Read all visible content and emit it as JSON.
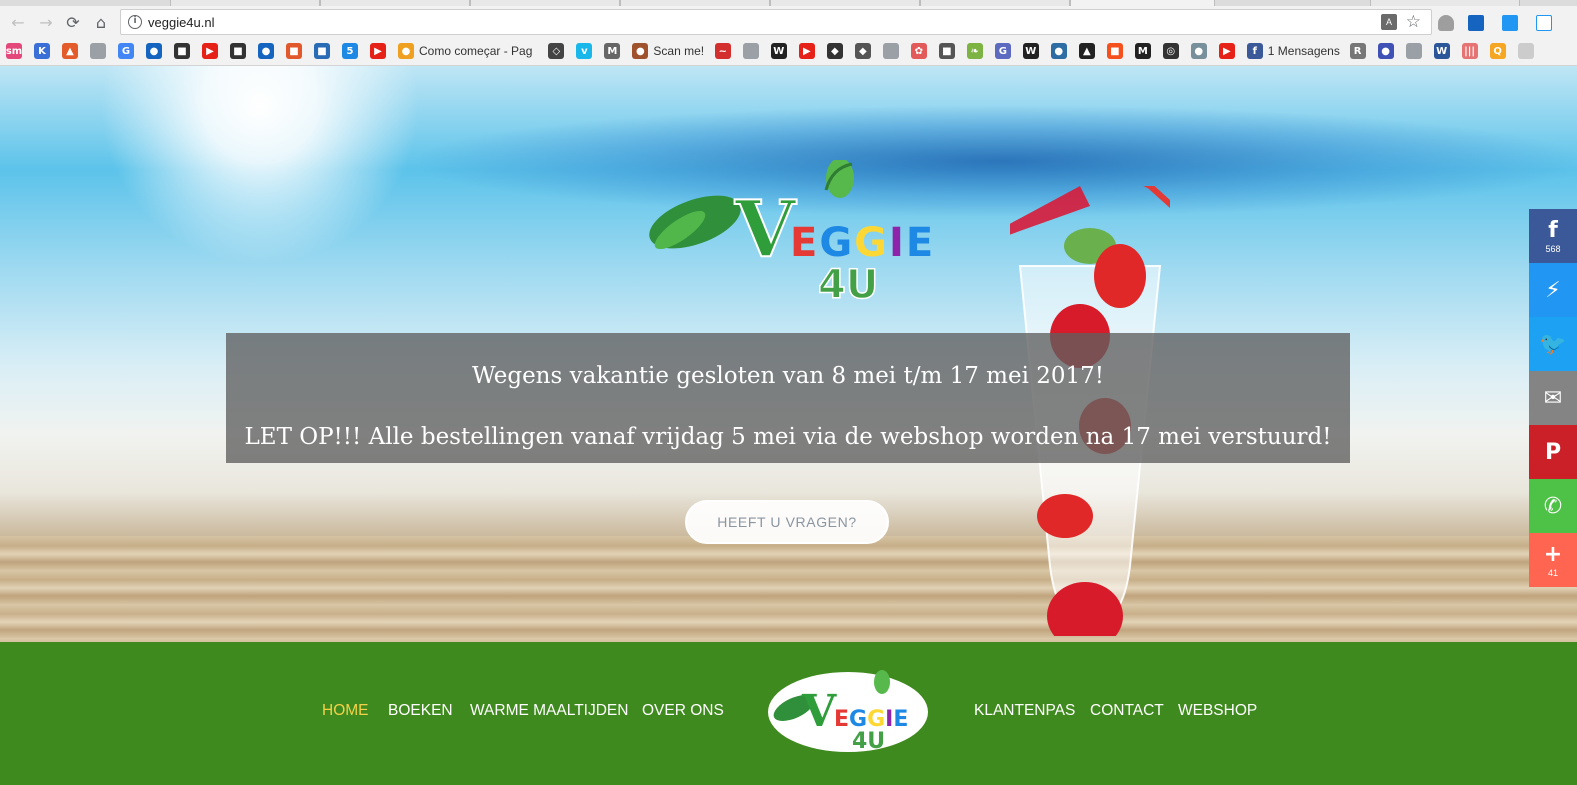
{
  "browser": {
    "url": "veggie4u.nl",
    "bookmarks": [
      {
        "icon": "sm",
        "label": "",
        "color": "#e4487a"
      },
      {
        "icon": "K",
        "label": "",
        "color": "#3a6fd8"
      },
      {
        "icon": "▲",
        "label": "",
        "color": "#e35a2b"
      },
      {
        "icon": "",
        "label": "",
        "color": "#9aa0a6"
      },
      {
        "icon": "G",
        "label": "",
        "color": "#4285f4"
      },
      {
        "icon": "●",
        "label": "",
        "color": "#1565c0"
      },
      {
        "icon": "■",
        "label": "",
        "color": "#333333"
      },
      {
        "icon": "▶",
        "label": "",
        "color": "#e62117"
      },
      {
        "icon": "■",
        "label": "",
        "color": "#333333"
      },
      {
        "icon": "●",
        "label": "",
        "color": "#1565c0"
      },
      {
        "icon": "■",
        "label": "",
        "color": "#e0582c"
      },
      {
        "icon": "■",
        "label": "",
        "color": "#2a6bb5"
      },
      {
        "icon": "5",
        "label": "",
        "color": "#1e88e5"
      },
      {
        "icon": "▶",
        "label": "",
        "color": "#e62117"
      },
      {
        "icon": "●",
        "label": "Como começar - Pag",
        "color": "#f0a020"
      },
      {
        "icon": "◇",
        "label": "",
        "color": "#444444"
      },
      {
        "icon": "v",
        "label": "",
        "color": "#1ab7ea"
      },
      {
        "icon": "M",
        "label": "",
        "color": "#666666"
      },
      {
        "icon": "●",
        "label": "Scan me!",
        "color": "#a0522d"
      },
      {
        "icon": "~",
        "label": "",
        "color": "#d32f2f"
      },
      {
        "icon": "",
        "label": "",
        "color": "#9aa0a6"
      },
      {
        "icon": "W",
        "label": "",
        "color": "#222222"
      },
      {
        "icon": "▶",
        "label": "",
        "color": "#e62117"
      },
      {
        "icon": "◆",
        "label": "",
        "color": "#333333"
      },
      {
        "icon": "◆",
        "label": "",
        "color": "#555555"
      },
      {
        "icon": "",
        "label": "",
        "color": "#9aa0a6"
      },
      {
        "icon": "✿",
        "label": "",
        "color": "#e35a5a"
      },
      {
        "icon": "■",
        "label": "",
        "color": "#555555"
      },
      {
        "icon": "❧",
        "label": "",
        "color": "#7cb342"
      },
      {
        "icon": "G",
        "label": "",
        "color": "#5c6bc0"
      },
      {
        "icon": "W",
        "label": "",
        "color": "#222222"
      },
      {
        "icon": "●",
        "label": "",
        "color": "#2e6da4"
      },
      {
        "icon": "▲",
        "label": "",
        "color": "#222222"
      },
      {
        "icon": "■",
        "label": "",
        "color": "#f4511e"
      },
      {
        "icon": "M",
        "label": "",
        "color": "#222222"
      },
      {
        "icon": "◎",
        "label": "",
        "color": "#333333"
      },
      {
        "icon": "●",
        "label": "",
        "color": "#78909c"
      },
      {
        "icon": "▶",
        "label": "",
        "color": "#e62117"
      },
      {
        "icon": "f",
        "label": "1 Mensagens",
        "color": "#3b5998"
      },
      {
        "icon": "R",
        "label": "",
        "color": "#777777"
      },
      {
        "icon": "●",
        "label": "",
        "color": "#3f51b5"
      },
      {
        "icon": "",
        "label": "",
        "color": "#9aa0a6"
      },
      {
        "icon": "W",
        "label": "",
        "color": "#2b579a"
      },
      {
        "icon": "|||",
        "label": "",
        "color": "#e57373"
      },
      {
        "icon": "Q",
        "label": "",
        "color": "#f5a623"
      },
      {
        "icon": "",
        "label": "",
        "color": "#cccccc"
      }
    ]
  },
  "hero": {
    "notice_line1": "Wegens vakantie gesloten van 8 mei t/m 17 mei 2017!",
    "notice_line2": "LET OP!!! Alle bestellingen vanaf vrijdag 5 mei via de webshop worden na 17 mei verstuurd!",
    "cta_label": "HEEFT U VRAGEN?",
    "logo_word": "VEGGIE",
    "logo_sub": "4U"
  },
  "share": [
    {
      "name": "facebook",
      "glyph": "f",
      "count": "568",
      "color": "#3b5998"
    },
    {
      "name": "messenger",
      "glyph": "⚡",
      "count": "",
      "color": "#2196f3"
    },
    {
      "name": "twitter",
      "glyph": "🐦",
      "count": "",
      "color": "#1da1f2"
    },
    {
      "name": "email",
      "glyph": "✉",
      "count": "",
      "color": "#848484"
    },
    {
      "name": "pinterest",
      "glyph": "P",
      "count": "",
      "color": "#cb2027"
    },
    {
      "name": "whatsapp",
      "glyph": "✆",
      "count": "",
      "color": "#4dc247"
    },
    {
      "name": "more",
      "glyph": "+",
      "count": "41",
      "color": "#ff6550"
    }
  ],
  "nav": {
    "left": [
      "HOME",
      "BOEKEN",
      "WARME MAALTIJDEN",
      "OVER ONS"
    ],
    "right": [
      "KLANTENPAS",
      "CONTACT",
      "WEBSHOP"
    ],
    "active": "HOME",
    "active_color": "#f3d24a",
    "bg_color": "#3f8a1e"
  }
}
